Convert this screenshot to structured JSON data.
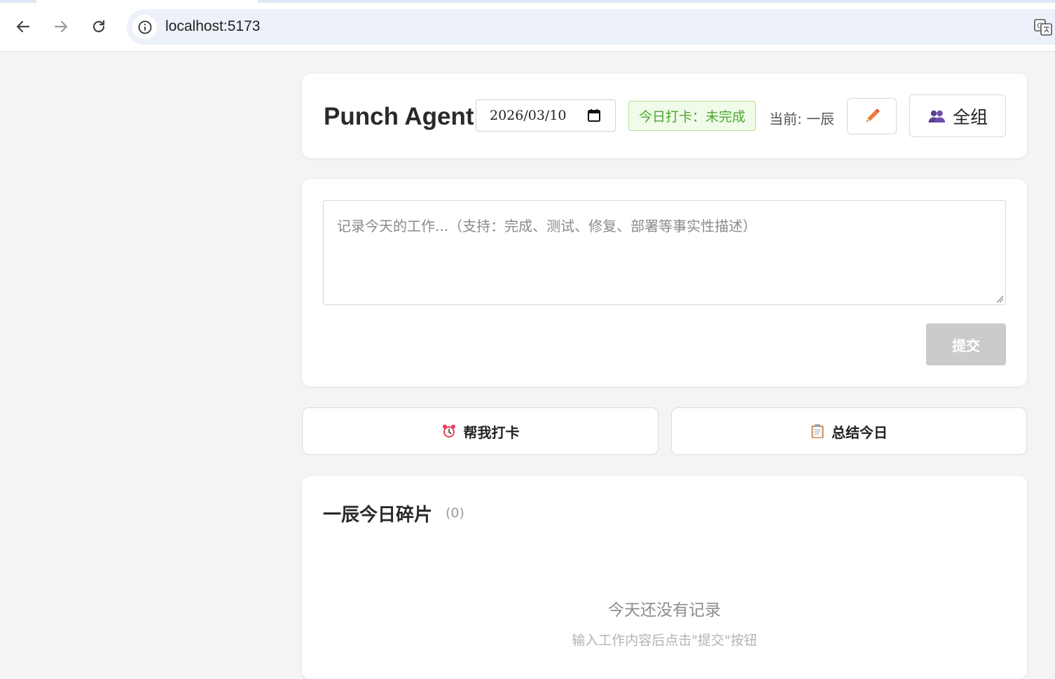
{
  "browser": {
    "url": "localhost:5173",
    "icons": [
      "back-arrow-icon",
      "forward-arrow-icon",
      "reload-icon",
      "info-icon",
      "translate-icon"
    ]
  },
  "header": {
    "app_title": "Punch Agent",
    "date_value": "2026/03/10",
    "status_badge": "今日打卡：未完成",
    "current_user": "当前: 一辰",
    "group_button_label": "全组",
    "edit_icon": "pencil-icon",
    "group_icon": "people-icon"
  },
  "input": {
    "placeholder": "记录今天的工作...（支持：完成、测试、修复、部署等事实性描述）",
    "value": "",
    "submit_label": "提交"
  },
  "actions": {
    "punch_label": "帮我打卡",
    "punch_icon": "alarm-clock-icon",
    "summary_label": "总结今日",
    "summary_icon": "clipboard-icon"
  },
  "fragments": {
    "title": "一辰今日碎片",
    "count": "(0)",
    "empty_title": "今天还没有记录",
    "empty_hint": "输入工作内容后点击\"提交\"按钮"
  },
  "colors": {
    "status_green": "#4ca52f",
    "submit_disabled": "#cbcbcb",
    "pencil_orange": "#f07a3c"
  }
}
